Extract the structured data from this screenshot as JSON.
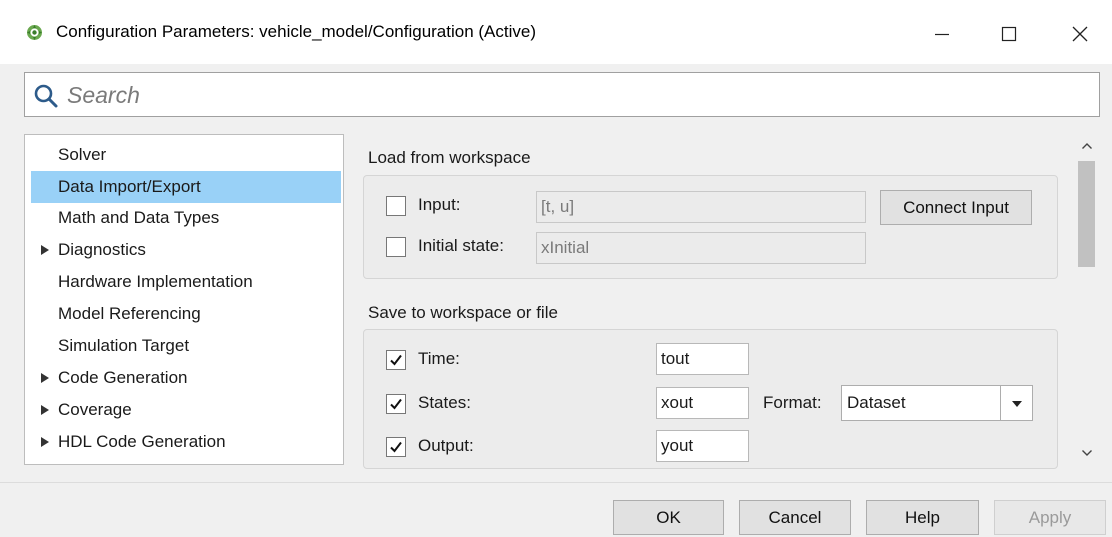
{
  "window": {
    "title": "Configuration Parameters: vehicle_model/Configuration (Active)",
    "icon": "simulink-app-icon",
    "controls": [
      "minimize-icon",
      "maximize-icon",
      "close-icon"
    ]
  },
  "search": {
    "placeholder": "Search",
    "value": ""
  },
  "tree": {
    "items": [
      {
        "label": "Solver",
        "expandable": false,
        "selected": false
      },
      {
        "label": "Data Import/Export",
        "expandable": false,
        "selected": true
      },
      {
        "label": "Math and Data Types",
        "expandable": false,
        "selected": false
      },
      {
        "label": "Diagnostics",
        "expandable": true,
        "selected": false
      },
      {
        "label": "Hardware Implementation",
        "expandable": false,
        "selected": false
      },
      {
        "label": "Model Referencing",
        "expandable": false,
        "selected": false
      },
      {
        "label": "Simulation Target",
        "expandable": false,
        "selected": false
      },
      {
        "label": "Code Generation",
        "expandable": true,
        "selected": false
      },
      {
        "label": "Coverage",
        "expandable": true,
        "selected": false
      },
      {
        "label": "HDL Code Generation",
        "expandable": true,
        "selected": false
      }
    ]
  },
  "load": {
    "title": "Load from workspace",
    "input": {
      "label": "Input:",
      "checked": false,
      "value": "[t, u]"
    },
    "initial_state": {
      "label": "Initial state:",
      "checked": false,
      "value": "xInitial"
    },
    "connect_button": "Connect Input"
  },
  "save": {
    "title": "Save to workspace or file",
    "time": {
      "label": "Time:",
      "checked": true,
      "value": "tout"
    },
    "states": {
      "label": "States:",
      "checked": true,
      "value": "xout"
    },
    "format": {
      "label": "Format:",
      "value": "Dataset"
    },
    "output": {
      "label": "Output:",
      "checked": true,
      "value": "yout"
    }
  },
  "footer": {
    "ok": "OK",
    "cancel": "Cancel",
    "help": "Help",
    "apply": "Apply"
  },
  "colors": {
    "selection": "#99d1f7",
    "window_bg": "#f0f0f0",
    "search_icon": "#2d5b8a"
  }
}
